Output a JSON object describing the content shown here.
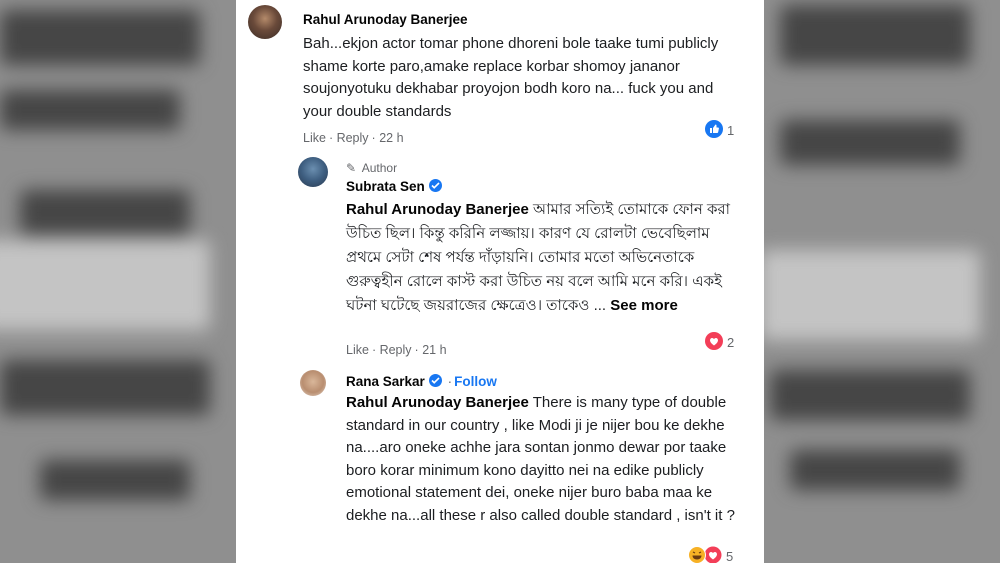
{
  "background": {
    "color": "#8f8f8f"
  },
  "colors": {
    "link": "#1877f2",
    "meta": "#65676b",
    "love": "#f33e58"
  },
  "comments": [
    {
      "author": "Rahul Arunoday Banerjee",
      "text": "Bah...ekjon actor tomar phone dhoreni bole taake tumi publicly shame korte paro,amake replace korbar shomoy jananor soujonyotuku dekhabar proyojon bodh koro na... fuck you and your double standards",
      "actions": {
        "like": "Like",
        "reply": "Reply",
        "time": "22 h"
      },
      "reaction": {
        "icon": "like-icon",
        "count": "1"
      }
    },
    {
      "author_badge": "Author",
      "author": "Subrata Sen",
      "tag": "Rahul Arunoday Banerjee",
      "text": " আমার সত্যিই তোমাকে ফোন করা উচিত ছিল। কিন্তু করিনি লজ্জায়। কারণ যে রোলটা ভেবেছিলাম প্রথমে সেটা শেষ পর্যন্ত দাঁড়ায়নি। তোমার মতো অভিনেতাকে গুরুত্বহীন রোলে কাস্ট করা উচিত নয় বলে আমি মনে করি। একই ঘটনা ঘটেছে জয়রাজের ক্ষেত্রেও। তাকেও ... ",
      "see_more": "See more",
      "actions": {
        "like": "Like",
        "reply": "Reply",
        "time": "21 h"
      },
      "reaction": {
        "icon": "heart-icon",
        "count": "2"
      }
    },
    {
      "author": "Rana Sarkar",
      "follow": "Follow",
      "separator": "·",
      "tag": "Rahul Arunoday Banerjee",
      "text": " There is many type of double standard in our country , like Modi ji je nijer bou ke dekhe na....aro oneke achhe jara sontan jonmo dewar por taake boro korar minimum kono dayitto nei na edike publicly emotional statement dei, oneke nijer buro baba maa ke dekhe na...all these r also called double standard , isn't it ?",
      "reaction": {
        "icon": "haha-heart-icon",
        "count": "5"
      }
    }
  ]
}
